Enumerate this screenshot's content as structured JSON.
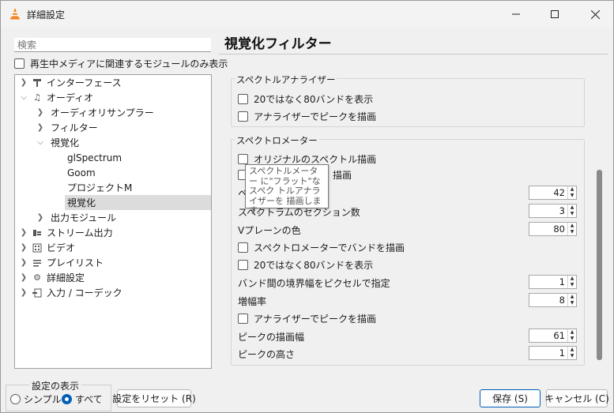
{
  "window": {
    "title": "詳細設定"
  },
  "search": {
    "placeholder": "検索"
  },
  "only_current_label": "再生中メディアに関連するモジュールのみ表示",
  "tree": {
    "items": [
      {
        "label": "インターフェース",
        "icon": "interface-icon",
        "arrow": "collapsed"
      },
      {
        "label": "オーディオ",
        "icon": "music-note-icon",
        "arrow": "expanded"
      },
      {
        "label": "オーディオリサンプラー",
        "arrow": "collapsed"
      },
      {
        "label": "フィルター",
        "arrow": "collapsed"
      },
      {
        "label": "視覚化",
        "arrow": "expanded"
      },
      {
        "label": "glSpectrum"
      },
      {
        "label": "Goom"
      },
      {
        "label": "プロジェクトM"
      },
      {
        "label": "視覚化",
        "selected": true
      },
      {
        "label": "出力モジュール",
        "arrow": "collapsed"
      },
      {
        "label": "ストリーム出力",
        "icon": "stream-output-icon",
        "arrow": "collapsed"
      },
      {
        "label": "ビデオ",
        "icon": "video-icon",
        "arrow": "collapsed"
      },
      {
        "label": "プレイリスト",
        "icon": "playlist-icon",
        "arrow": "collapsed"
      },
      {
        "label": "詳細設定",
        "icon": "gear-icon",
        "arrow": "collapsed"
      },
      {
        "label": "入力 / コーデック",
        "icon": "input-codec-icon",
        "arrow": "collapsed"
      }
    ]
  },
  "panel": {
    "title": "視覚化フィルター",
    "analyzer_group": {
      "label": "スペクトルアナライザー",
      "options": [
        "20ではなく80バンドを表示",
        "アナライザーでピークを描画"
      ]
    },
    "meter_group": {
      "label": "スペクトロメーター",
      "opt_original": "オリジナルのスペクトル描画",
      "opt_draw_partial": "描画",
      "label_bands": "ベ",
      "value_bands": "42",
      "label_sections": "スペクトラムのセクション数",
      "value_sections": "3",
      "label_vplane": "Vプレーンの色",
      "value_vplane": "80",
      "opt_draw_bands": "スペクトロメーターでバンドを描画",
      "opt_80bands": "20ではなく80バンドを表示",
      "label_band_sep": "バンド間の境界幅をピクセルで指定",
      "value_band_sep": "1",
      "label_amp": "増幅率",
      "value_amp": "8",
      "opt_peaks": "アナライザーでピークを描画",
      "label_peak_width": "ピークの描画幅",
      "value_peak_width": "61",
      "label_peak_height": "ピークの高さ",
      "value_peak_height": "1"
    },
    "tooltip": "スペクトルメーター に\"フラット\"なスペク トルアナライザーを 描画します。"
  },
  "footer": {
    "show_settings_label": "設定の表示",
    "radio_simple": "シンプル",
    "radio_all": "すべて",
    "reset_button": "設定をリセット (R)",
    "save_button": "保存 (S)",
    "cancel_button": "キャンセル (C)"
  },
  "colors": {
    "accent": "#005fb8",
    "vlc_orange": "#f58220"
  }
}
